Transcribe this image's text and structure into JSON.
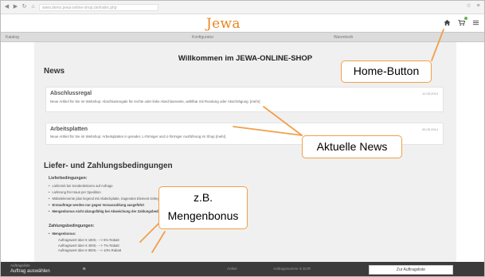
{
  "browser": {
    "url": "www.demo.jewa-online-shop.de/index.php"
  },
  "header": {
    "logo": "Jewa"
  },
  "tabs": [
    "Katalog",
    "Konfigurator",
    "Warenkorb"
  ],
  "main": {
    "welcome": "Willkommen im JEWA-ONLINE-SHOP",
    "news_heading": "News",
    "news": [
      {
        "title": "Abschlussregal",
        "text": "Neue Artikel für Sie im Webshop: Abschlussregale für rechte oder linke Abschlussseite, wählbar mit Rundung oder Abschrägung. [mehr]",
        "date": "12.05.2014"
      },
      {
        "title": "Arbeitsplatten",
        "text": "Neue Artikel für Sie im Webshop: Arbeitsplatten in gerader, L-förmiger und U-förmiger Ausführung im Shop [mehr]",
        "date": "05.05.2014"
      }
    ],
    "terms_heading": "Liefer- und Zahlungsbedingungen",
    "delivery_heading": "Lieferbedingungen:",
    "delivery_items": [
      {
        "text": "Lieferzeit bei Sonderdekoren auf Anfrage",
        "bold": false
      },
      {
        "text": "Lieferung frei Haus per Spedition",
        "bold": false
      },
      {
        "text": "Möbelelemente plan liegend mit Abdeckplatte, tragendes Element zerlegt",
        "bold": false
      },
      {
        "text": "Erstaufträge werden nur gegen Vorauszahlung ausgeführt",
        "bold": true
      },
      {
        "text": "Mengenbonus nicht abzugsfähig bei Abweichung der Zahlungsbedingungen",
        "bold": true
      }
    ],
    "payment_heading": "Zahlungsbedingungen:",
    "payment_bullet": "Mengenbonus:",
    "bonus_lines": [
      "Auftragswert über € 1800,-  --> 5%   Rabatt",
      "Auftragswert über € 4000,-  --> 7%   Rabatt",
      "Auftragswert über € 9000,-  --> 10% Rabatt"
    ]
  },
  "bottom_bar": {
    "order_label": "Auftragsliste",
    "order_value": "Auftrag auswählen",
    "mid_labels": [
      "Artikel",
      "Auftragssumme in EUR"
    ],
    "to_list_button": "Zur Auftragsliste"
  },
  "callouts": {
    "home": "Home-Button",
    "news": "Aktuelle News",
    "bonus_line1": "z.B.",
    "bonus_line2": "Mengenbonus"
  },
  "colors": {
    "logo": "#e8871e",
    "callout_border": "#f0a04b",
    "bottom_bar": "#3b3b3b"
  }
}
